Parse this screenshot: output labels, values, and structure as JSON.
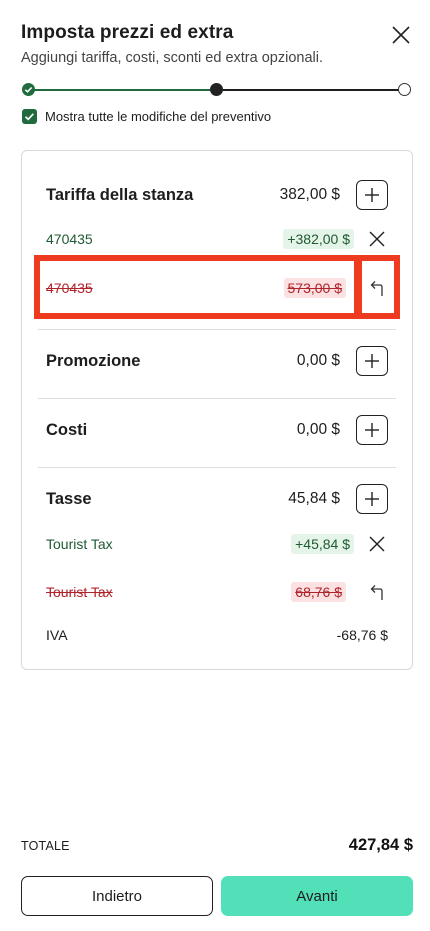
{
  "header": {
    "title": "Imposta prezzi ed extra",
    "subtitle": "Aggiungi tariffa, costi, sconti ed extra opzionali."
  },
  "stepper": {
    "total_steps": 3,
    "current_step": 2
  },
  "show_changes": {
    "checked": true,
    "label": "Mostra tutte le modifiche del preventivo"
  },
  "sections": {
    "room_rate": {
      "title": "Tariffa della stanza",
      "amount": "382,00 $",
      "added": {
        "label": "470435",
        "amount": "+382,00 $"
      },
      "removed": {
        "label": "470435",
        "amount": "573,00 $"
      }
    },
    "promotion": {
      "title": "Promozione",
      "amount": "0,00 $"
    },
    "costs": {
      "title": "Costi",
      "amount": "0,00 $"
    },
    "taxes": {
      "title": "Tasse",
      "amount": "45,84 $",
      "added": {
        "label": "Tourist Tax",
        "amount": "+45,84 $"
      },
      "removed": {
        "label": "Tourist Tax",
        "amount": "68,76 $"
      },
      "vat": {
        "label": "IVA",
        "amount": "-68,76 $"
      }
    }
  },
  "total": {
    "label": "TOTALE",
    "value": "427,84 $"
  },
  "buttons": {
    "back": "Indietro",
    "next": "Avanti"
  },
  "colors": {
    "brand_green": "#1f6b3e",
    "added_bg": "#e5f4e8",
    "removed_bg": "#fbe1e2",
    "removed_text": "#b0232a",
    "highlight": "#ee3a1f",
    "primary_button": "#52e0b8"
  },
  "icons": {
    "close": "close-icon",
    "check": "check-icon",
    "plus": "plus-icon",
    "remove": "x-icon",
    "undo": "undo-arrow-icon"
  }
}
